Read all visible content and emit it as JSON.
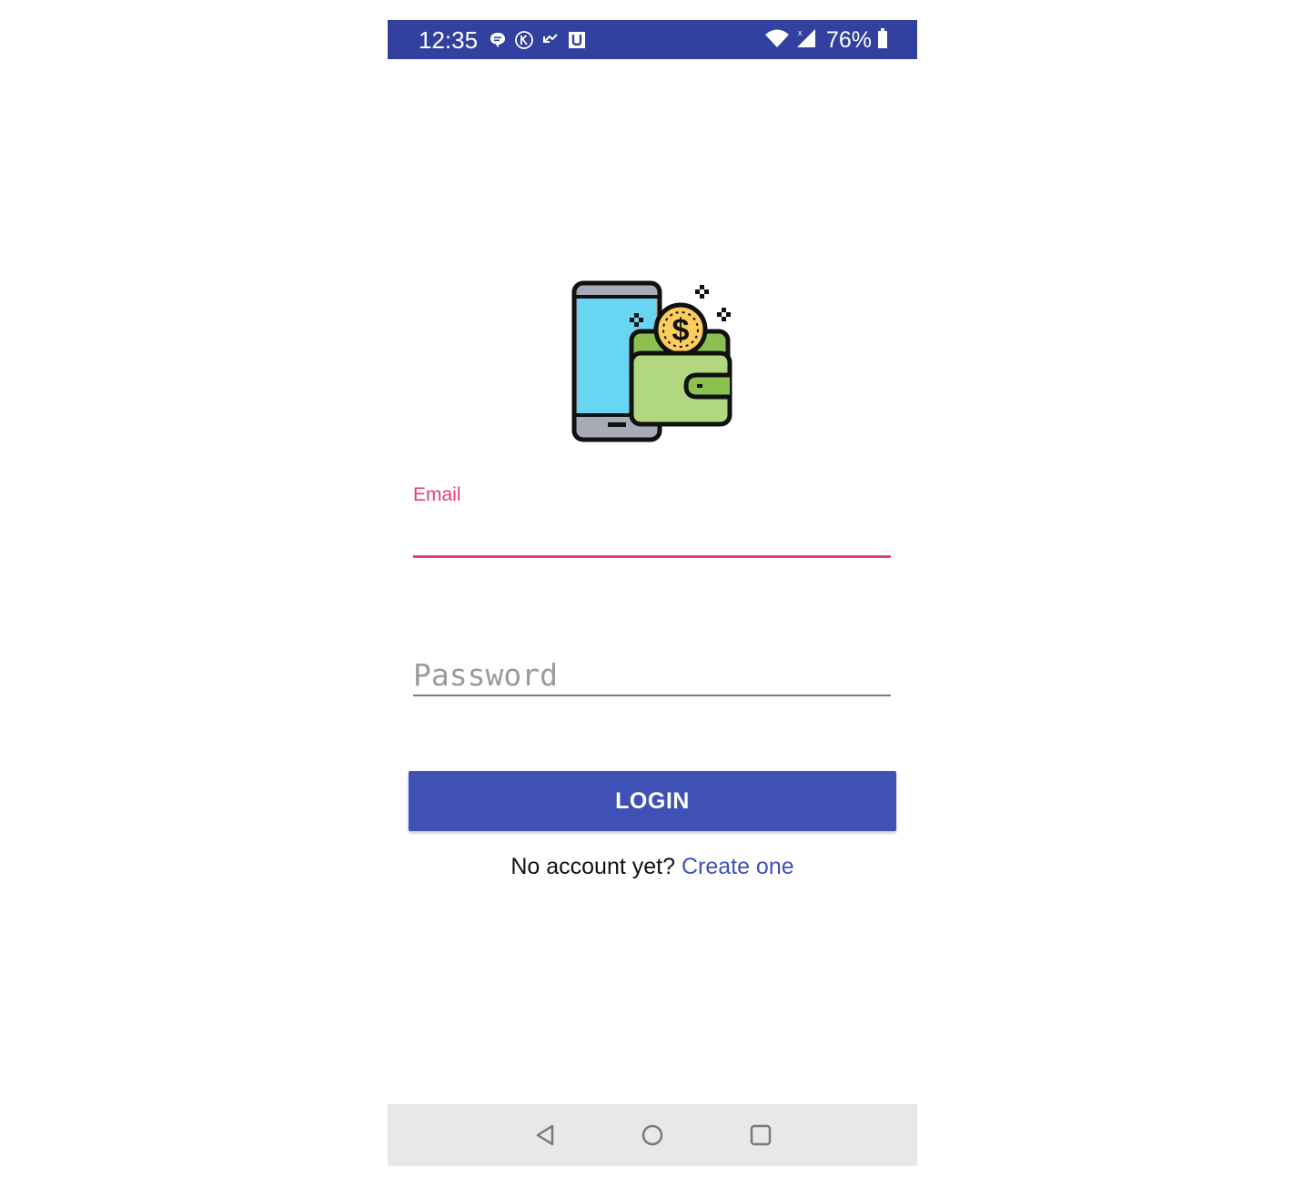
{
  "status_bar": {
    "time": "12:35",
    "battery_percent": "76%",
    "left_icons": [
      "message-icon",
      "k-circle-icon",
      "missed-call-icon",
      "u-box-icon"
    ],
    "right_icons": [
      "wifi-icon",
      "signal-icon",
      "battery-icon"
    ],
    "background_color": "#3241a0"
  },
  "logo": {
    "icon": "mobile-wallet-icon"
  },
  "login_form": {
    "email_label": "Email",
    "email_value": "",
    "password_placeholder": "Password",
    "password_value": "",
    "login_button_label": "LOGIN",
    "signup_prompt": "No account yet?",
    "signup_link": "Create one",
    "accent_color": "#e73c7e",
    "primary_color": "#3f51b5"
  },
  "nav_bar": {
    "buttons": [
      "back-icon",
      "home-icon",
      "recents-icon"
    ]
  }
}
